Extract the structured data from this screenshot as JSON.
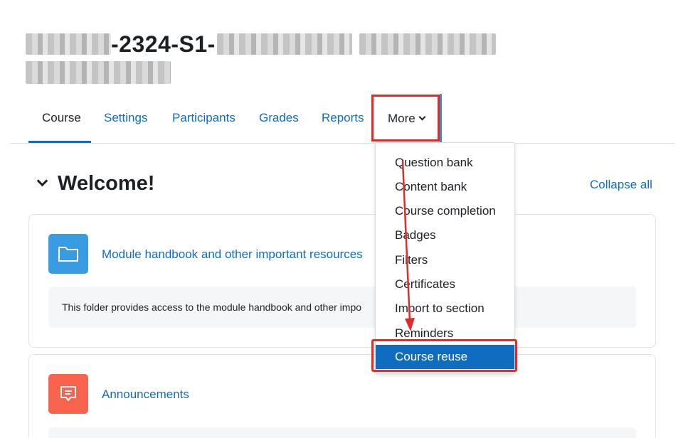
{
  "header": {
    "title_visible": "-2324-S1-"
  },
  "nav": {
    "course": "Course",
    "settings": "Settings",
    "participants": "Participants",
    "grades": "Grades",
    "reports": "Reports",
    "more": "More"
  },
  "section": {
    "title": "Welcome!",
    "collapse_all": "Collapse all"
  },
  "activities": [
    {
      "icon": "folder-icon",
      "name": "Module handbook and other important resources",
      "description": "This folder provides access to the module handbook and other impo"
    },
    {
      "icon": "forum-icon",
      "name": "Announcements"
    }
  ],
  "more_menu": {
    "items": [
      "Question bank",
      "Content bank",
      "Course completion",
      "Badges",
      "Filters",
      "Certificates",
      "Import to section",
      "Reminders"
    ],
    "selected": "Course reuse"
  },
  "colors": {
    "link": "#0f6cbf",
    "highlight_box": "#e02b2b",
    "folder_icon_bg": "#399be2",
    "forum_icon_bg": "#f7634d"
  }
}
